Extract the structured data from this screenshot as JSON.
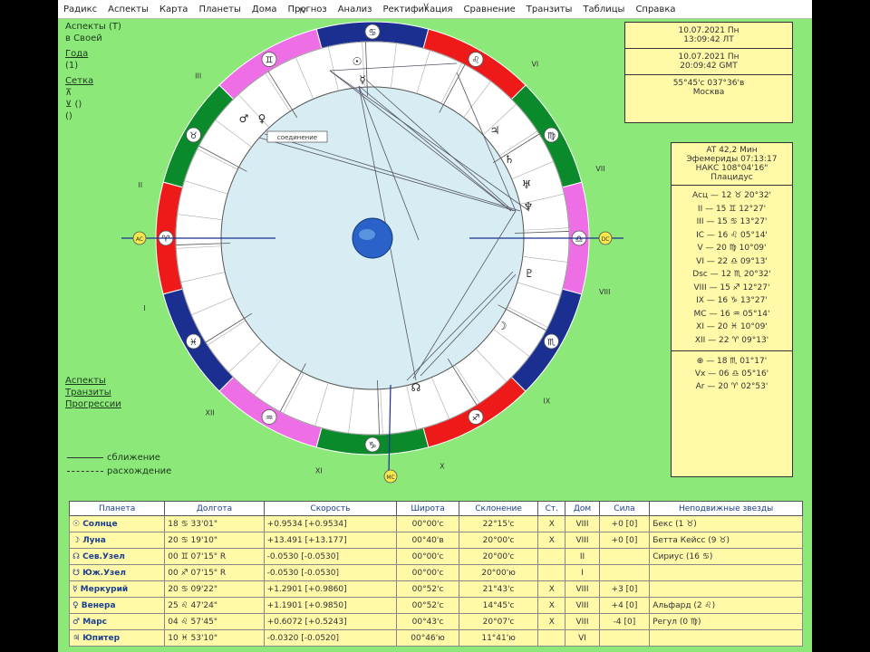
{
  "menu": [
    "Радикс",
    "Аспекты",
    "Карта",
    "Планеты",
    "Дома",
    "Прогноз",
    "Анализ",
    "Ректификация",
    "Сравнение",
    "Транзиты",
    "Таблицы",
    "Справка"
  ],
  "left_panel": {
    "items": [
      "Аспекты (Т)",
      "в Своей",
      "Года",
      "(1)",
      "Сетка",
      "⊼",
      "⊻ ()",
      "()"
    ],
    "bottom_items": [
      "Аспекты",
      "Транзиты",
      "Прогрессии"
    ],
    "legend": [
      "сближение",
      "расхождение"
    ]
  },
  "info_box_1": {
    "lines": [
      "10.07.2021 Пн",
      "13:09:42 ЛТ",
      "10.07.2021 Пн",
      "20:09:42 GMT",
      "55°45'с  037°36'в",
      "Москва"
    ]
  },
  "info_box_2": {
    "lines": [
      "AT 42,2 Мин",
      "Эфемериды 07:13:17",
      "НАКС 108°04'16\"",
      "Плацидус"
    ],
    "houses": [
      "Асц — 12 ♉ 20°32'",
      "II — 15 ♊ 12°27'",
      "III — 15 ♋ 13°27'",
      "IC — 16 ♌ 05°14'",
      "V — 20 ♍ 10°09'",
      "VI — 22 ♎ 09°13'",
      "Dsc — 12 ♏ 20°32'",
      "VIII — 15 ♐ 12°27'",
      "IX — 16 ♑ 13°27'",
      "MC — 16 ♒ 05°14'",
      "XI — 20 ♓ 10°09'",
      "XII — 22 ♈ 09°13'"
    ],
    "extra": [
      "⊕ — 18 ♏ 01°17'",
      "Vx — 06 ♎ 05°16'",
      "Ar — 20 ♈ 02°53'"
    ]
  },
  "wheel": {
    "center_label": "Земля",
    "aspect_label": "соединение",
    "asc_marker": "AC",
    "dsc_marker": "DC",
    "mc_marker": "MC",
    "sign_glyphs": [
      "♋",
      "♊",
      "♉",
      "♈",
      "♓",
      "♒",
      "♑",
      "♐",
      "♏",
      "♎",
      "♍",
      "♌"
    ],
    "planet_glyphs": [
      "☉",
      "☿",
      "♂",
      "♀",
      "♃",
      "♄",
      "♅",
      "♆",
      "♇",
      "☽",
      "☊"
    ],
    "house_numbers": [
      "I",
      "II",
      "III",
      "IV",
      "V",
      "VI",
      "VII",
      "VIII",
      "IX",
      "X",
      "XI",
      "XII"
    ]
  },
  "table": {
    "headers": [
      "Планета",
      "Долгота",
      "Скорость",
      "Широта",
      "Склонение",
      "Ст.",
      "Дом",
      "Сила",
      "Неподвижные звезды"
    ],
    "rows": [
      {
        "glyph": "☉",
        "name": "Солнце",
        "lon": "18 ♋ 33'01\"",
        "speed": "+0.9534 [+0.9534]",
        "lat": "00°00'с",
        "decl": "22°15'с",
        "st": "X",
        "house": "VIII",
        "force": "+0 [0]",
        "stars": "Бекс (1 ♉)"
      },
      {
        "glyph": "☽",
        "name": "Луна",
        "lon": "20 ♋ 19'10\"",
        "speed": "+13.491 [+13.177]",
        "lat": "00°40'в",
        "decl": "20°00'с",
        "st": "X",
        "house": "VIII",
        "force": "+0 [0]",
        "stars": "Бетта Кейсс (9 ♉)"
      },
      {
        "glyph": "☊",
        "name": "Сев.Узел",
        "lon": "00 ♊ 07'15\" R",
        "speed": "-0.0530 [-0.0530]",
        "lat": "00°00'с",
        "decl": "20°00'с",
        "st": "",
        "house": "II",
        "force": "",
        "stars": "Сириус (16 ♋)"
      },
      {
        "glyph": "☋",
        "name": "Юж.Узел",
        "lon": "00 ♐ 07'15\" R",
        "speed": "-0.0530 [-0.0530]",
        "lat": "00°00'с",
        "decl": "20°00'ю",
        "st": "",
        "house": "I",
        "force": "",
        "stars": ""
      },
      {
        "glyph": "☿",
        "name": "Меркурий",
        "lon": "20 ♋ 09'22\"",
        "speed": "+1.2901 [+0.9860]",
        "lat": "00°52'с",
        "decl": "21°43'с",
        "st": "X",
        "house": "VIII",
        "force": "+3 [0]",
        "stars": ""
      },
      {
        "glyph": "♀",
        "name": "Венера",
        "lon": "25 ♌ 47'24\"",
        "speed": "+1.1901 [+0.9850]",
        "lat": "00°52'с",
        "decl": "14°45'с",
        "st": "X",
        "house": "VIII",
        "force": "+4 [0]",
        "stars": "Альфард (2 ♌)"
      },
      {
        "glyph": "♂",
        "name": "Марс",
        "lon": "04 ♌ 57'45\"",
        "speed": "+0.6072 [+0.5243]",
        "lat": "00°43'с",
        "decl": "20°07'с",
        "st": "X",
        "house": "VIII",
        "force": "-4 [0]",
        "stars": "Регул (0 ♍)"
      },
      {
        "glyph": "♃",
        "name": "Юпитер",
        "lon": "10 ♓ 53'10\"",
        "speed": "-0.0320 [-0.0520]",
        "lat": "00°46'ю",
        "decl": "11°41'ю",
        "st": "",
        "house": "VI",
        "force": "",
        "stars": ""
      }
    ]
  }
}
